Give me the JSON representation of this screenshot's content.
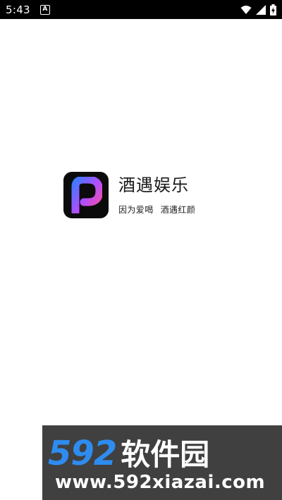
{
  "status_bar": {
    "time": "5:43",
    "notification_glyph": "A",
    "icons": [
      "wifi-icon",
      "signal-icon",
      "battery-charging-icon"
    ]
  },
  "splash": {
    "app_name": "酒遇娱乐",
    "slogan_part1": "因为爱喝",
    "slogan_part2": "酒遇红颜",
    "logo_letter": "P",
    "logo_colors": [
      "#3a7bff",
      "#b04dff",
      "#ff4f9a"
    ]
  },
  "watermark": {
    "number": "592",
    "brand": "软件园",
    "url": "www.592xiazai.com"
  }
}
